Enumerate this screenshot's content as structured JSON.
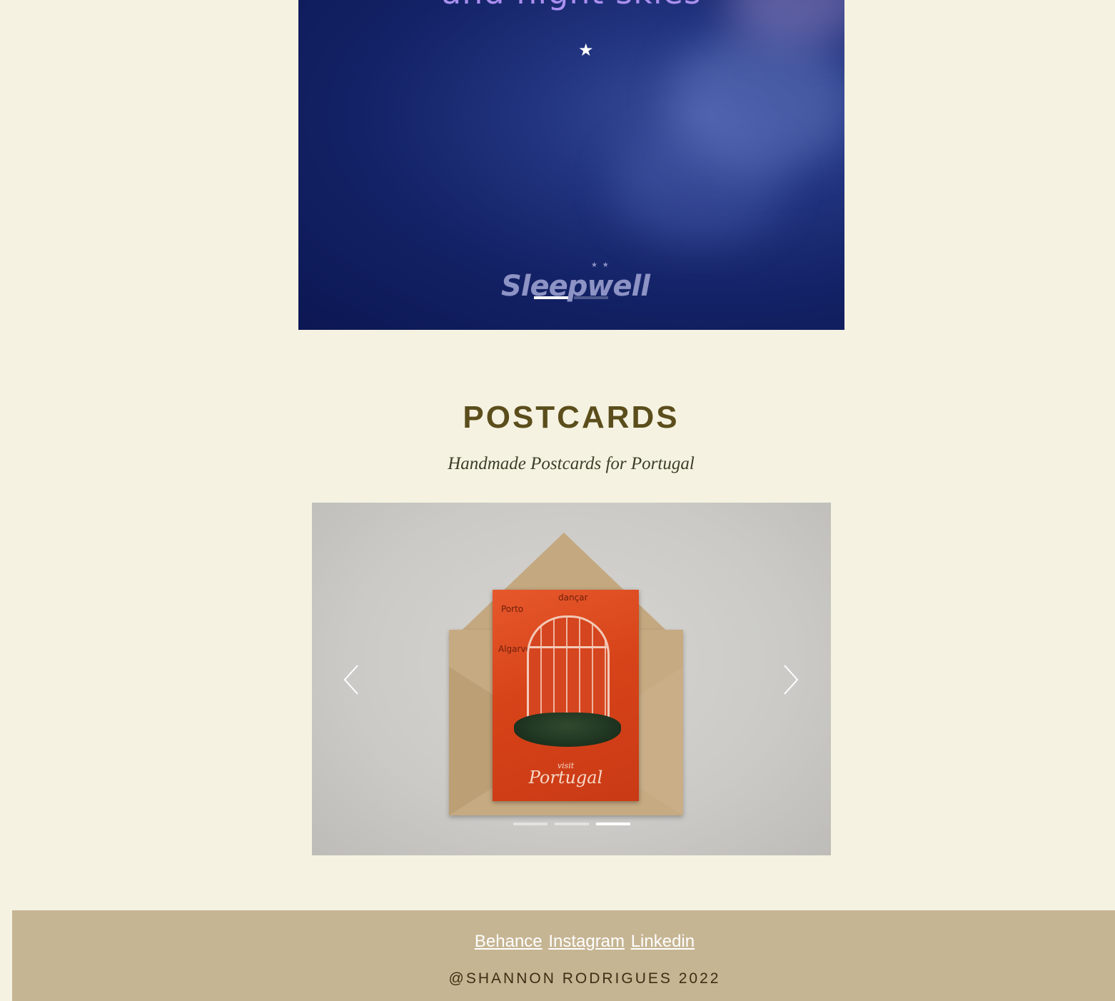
{
  "hero": {
    "headline": "and night skies",
    "brand": "Sleepwell",
    "slides": 2,
    "active_slide": 1
  },
  "postcards": {
    "title": "POSTCARDS",
    "subtitle": "Handmade Postcards for Portugal",
    "slides": 3,
    "active_slide": 3,
    "postcard_text": {
      "word1": "dançar",
      "word2": "Porto",
      "word3": "Algarve",
      "visit": "visit",
      "country": "Portugal"
    }
  },
  "footer": {
    "links": [
      "Behance",
      "Instagram",
      "Linkedin"
    ],
    "copyright": "@SHANNON RODRIGUES 2022"
  },
  "colors": {
    "page_bg": "#f5f2e1",
    "title": "#5b4e1c",
    "footer_bg": "#c6b593",
    "footer_link": "#ffffff"
  }
}
